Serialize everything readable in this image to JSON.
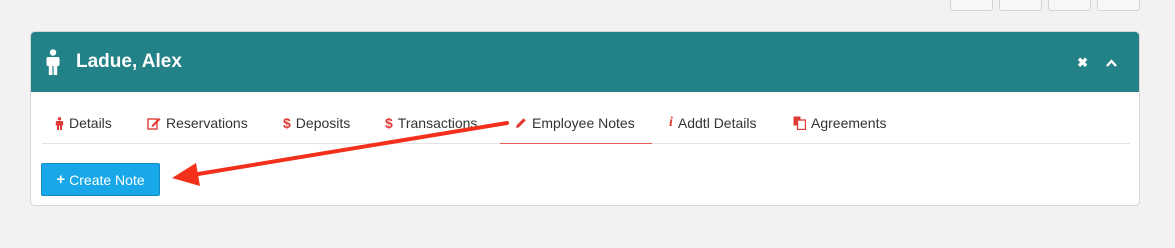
{
  "header": {
    "title": "Ladue, Alex",
    "close_label": "✖",
    "collapse_label": "⌃"
  },
  "tabs": [
    {
      "label": "Details",
      "icon": "person-icon"
    },
    {
      "label": "Reservations",
      "icon": "edit-icon"
    },
    {
      "label": "Deposits",
      "icon": "dollar-icon"
    },
    {
      "label": "Transactions",
      "icon": "dollar-icon"
    },
    {
      "label": "Employee Notes",
      "icon": "pencil-icon",
      "active": true
    },
    {
      "label": "Addtl Details",
      "icon": "info-icon"
    },
    {
      "label": "Agreements",
      "icon": "documents-icon"
    }
  ],
  "actions": {
    "create_note_label": "Create Note",
    "create_note_icon": "plus-icon"
  },
  "colors": {
    "header_bg": "#238287",
    "accent_red": "#e03a36",
    "button_bg": "#18a7e9",
    "annotation_arrow": "#f2301b"
  }
}
